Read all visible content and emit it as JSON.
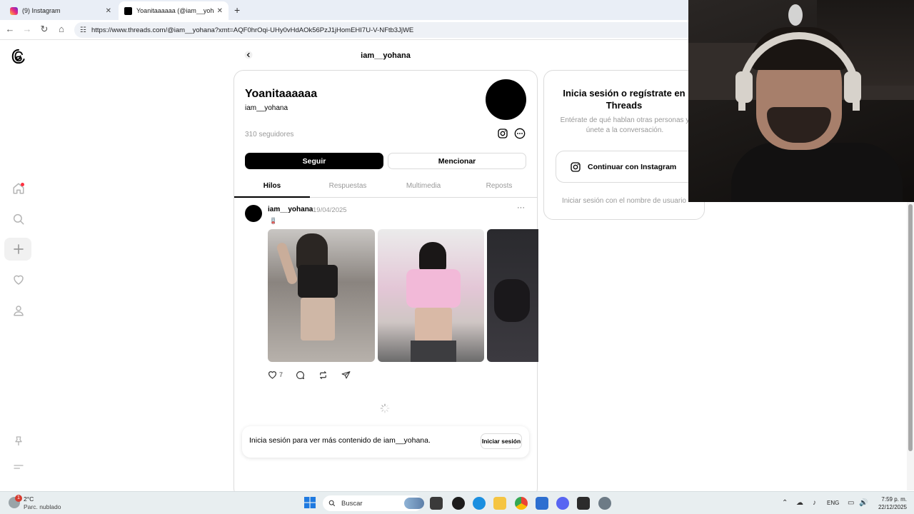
{
  "browser": {
    "tabs": [
      {
        "title": "(9) Instagram",
        "active": false
      },
      {
        "title": "Yoanitaaaaaa (@iam__yohana) •",
        "active": true
      }
    ],
    "url": "https://www.threads.com/@iam__yohana?xmt=AQF0hrOqi-UHy0vHdAOk56PzJ1jHomEHI7U-V-NFtb3JjWE"
  },
  "header": {
    "title": "iam__yohana"
  },
  "profile": {
    "display_name": "Yoanitaaaaaa",
    "username": "iam__yohana",
    "followers": "310 seguidores",
    "follow_label": "Seguir",
    "mention_label": "Mencionar"
  },
  "tabs": [
    "Hilos",
    "Respuestas",
    "Multimedia",
    "Reposts"
  ],
  "post": {
    "username": "iam__yohana",
    "date": "19/04/2025",
    "emoji": "🪫",
    "likes": "7",
    "more": "···"
  },
  "login_banner": {
    "text": "Inicia sesión para ver más contenido de iam__yohana.",
    "button": "Iniciar sesión"
  },
  "signin_card": {
    "title": "Inicia sesión o regístrate en Threads",
    "subtitle": "Entérate de qué hablan otras personas y únete a la conversación.",
    "instagram_button": "Continuar con Instagram",
    "username_login": "Iniciar sesión con el nombre de usuario"
  },
  "taskbar": {
    "weather_temp": "2°C",
    "weather_desc": "Parc. nublado",
    "search_placeholder": "Buscar",
    "lang": "ENG",
    "time": "7:59 p. m.",
    "date": "22/12/2025",
    "weather_badge": "1"
  },
  "colors": {
    "notification": "#ff3040",
    "instagram_tab": "#e1306c"
  }
}
